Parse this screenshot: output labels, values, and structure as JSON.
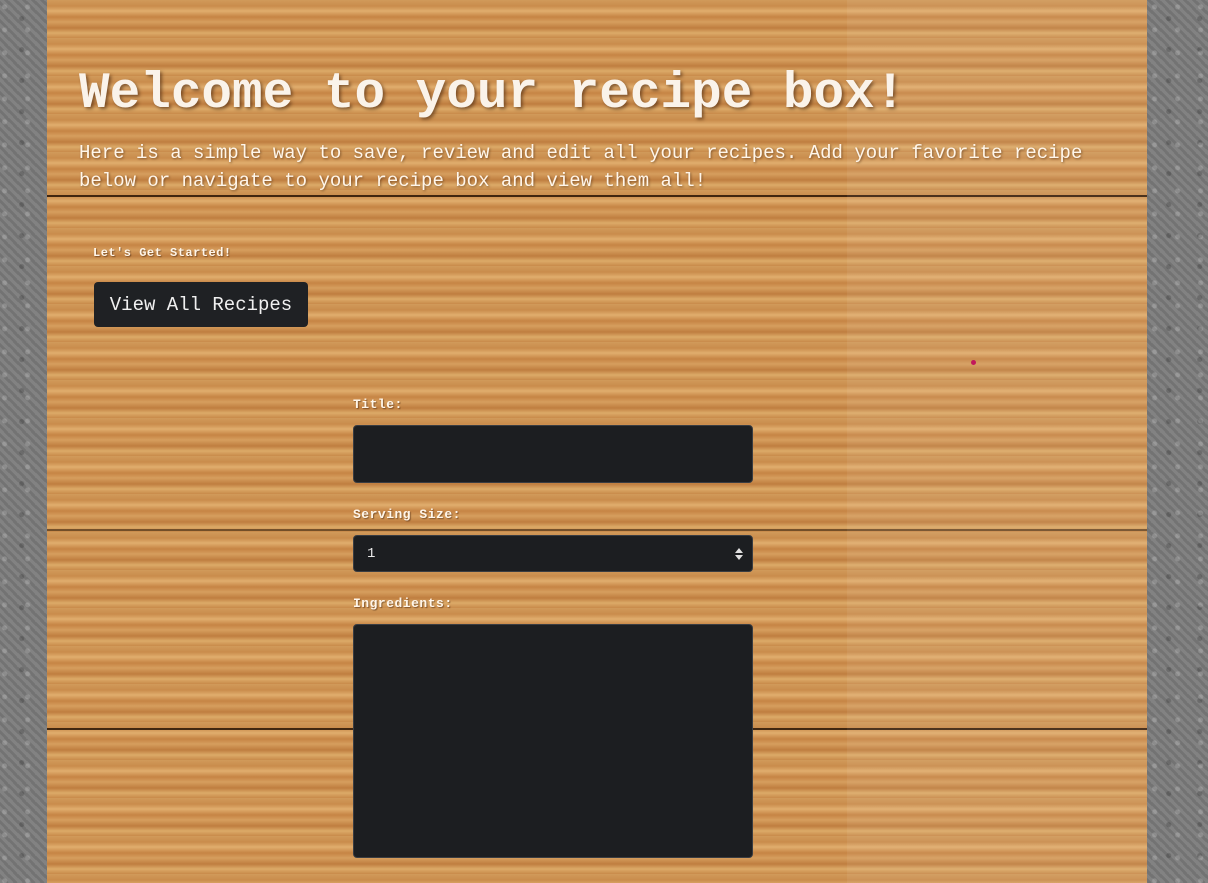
{
  "header": {
    "title": "Welcome to your recipe box!",
    "intro": "Here is a simple way to save, review and edit all your recipes. Add your favorite recipe below or navigate to your recipe box and view them all!"
  },
  "actions": {
    "get_started_label": "Let's Get Started!",
    "view_all_button": "View All Recipes"
  },
  "form": {
    "title_label": "Title:",
    "title_value": "",
    "serving_label": "Serving Size:",
    "serving_value": "1",
    "ingredients_label": "Ingredients:",
    "ingredients_value": ""
  },
  "colors": {
    "text": "#faf3ea",
    "button_bg": "#1f2124",
    "field_bg": "#1c1e21",
    "wood": "#c7894a"
  }
}
